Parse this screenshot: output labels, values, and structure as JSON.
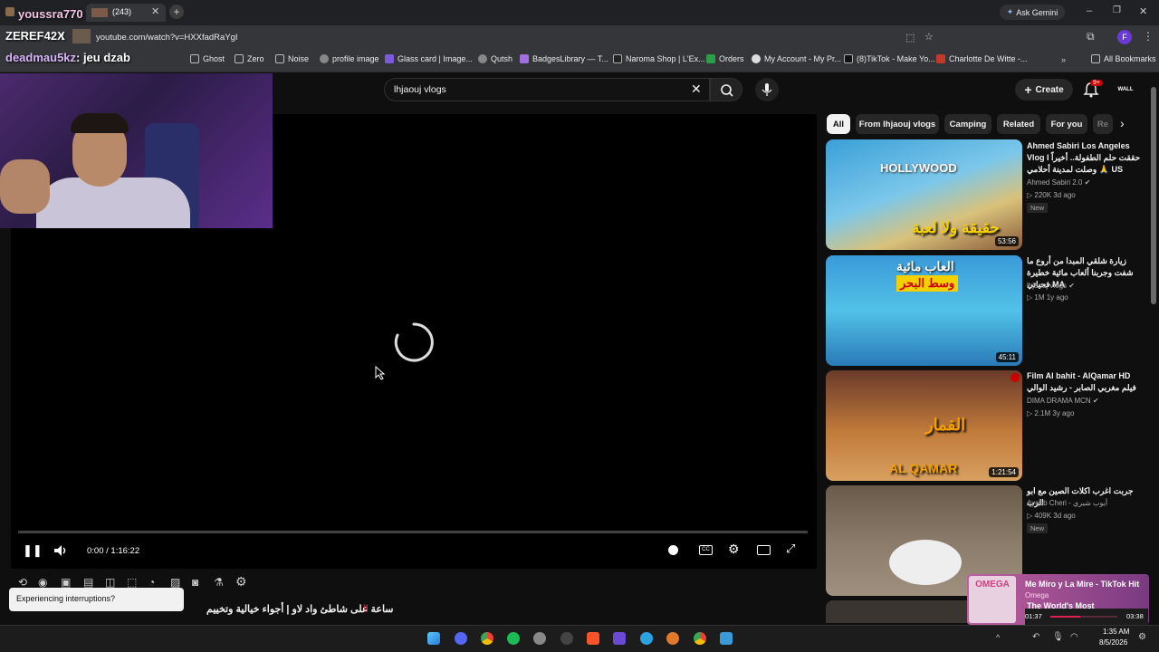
{
  "overlay": {
    "user1": "youssra770",
    "user2": "ZEREF42X",
    "user3": "deadmau5kz",
    "msg3": ": jeu dzab",
    "tab_count": "(243)"
  },
  "browser": {
    "url": "youtube.com/watch?v=HXXfadRaYgI",
    "ask_gemini": "Ask Gemini",
    "bookmarks": [
      "Ghost",
      "Zero",
      "Noise",
      "profile image",
      "Glass card | Image...",
      "Qutsh",
      "BadgesLibrary — T...",
      "Naroma Shop | L'Ex...",
      "Orders",
      "My Account - My Pr...",
      "(8)TikTok - Make Yo...",
      "Charlotte De Witte -..."
    ],
    "all_bookmarks": "All Bookmarks"
  },
  "youtube": {
    "search_value": "lhjaouj vlogs",
    "create_label": "Create",
    "notif_count": "9+",
    "chips": [
      "All",
      "From lhjaouj vlogs",
      "Camping",
      "Related",
      "For you",
      "Re"
    ],
    "player": {
      "time": "0:00 / 1:16:22"
    },
    "interruption": "Experiencing interruptions?",
    "video_title": "ساعة على شاطئ واد لاو | أجواء خيالية وتخييم",
    "videos": [
      {
        "title": "Ahmed Sabiri Los Angeles Vlog I حققت حلم الطفولة.. أخيراً وصلت لمدينة أحلامي 🙏 US",
        "channel": "Ahmed Sabiri 2.0",
        "meta": "220K  3d ago",
        "badge": "New",
        "duration": "53:56",
        "thumb_text": "حقيقة ولا لعبة",
        "thumb_top": "HOLLYWOOD"
      },
      {
        "title": "زيارة شلقي المبدا من أروع ما شفت وجربنا ألعاب مائية خطيرة MA فحياتي",
        "channel": "lhjaouj vlogs",
        "meta": "1M  1y ago",
        "badge": "",
        "duration": "45:11",
        "thumb_text": "وسط البحر",
        "thumb_top": "العاب مائية"
      },
      {
        "title": "Film Al bahit -  AlQamar HD فيلم مغربي الصابر - رشيد الوالي",
        "channel": "DIMA DRAMA MCN",
        "meta": "2.1M  3y ago",
        "badge": "",
        "duration": "1:21:54",
        "thumb_text": "AL QAMAR",
        "thumb_top": "القمار"
      },
      {
        "title": "جربت اغرب اكلات الصين مع ابو الرب",
        "channel": "Ayoub Cheri - أيوب شيري",
        "meta": "409K  3d ago",
        "badge": "New",
        "duration": "",
        "thumb_text": "",
        "thumb_top": ""
      }
    ]
  },
  "music": {
    "title": "Me Miro y La Mire - TikTok Hit",
    "artist": "Omega",
    "subtitle": "The World's Most",
    "cover": "OMEGA",
    "elapsed": "01:37",
    "total": "03:38",
    "progress": 0.44
  },
  "taskbar": {
    "time": "1:35 AM",
    "date": "8/5/2026"
  },
  "colors": {
    "yt_red": "#ff0000",
    "accent_purple": "#8a2be2"
  }
}
